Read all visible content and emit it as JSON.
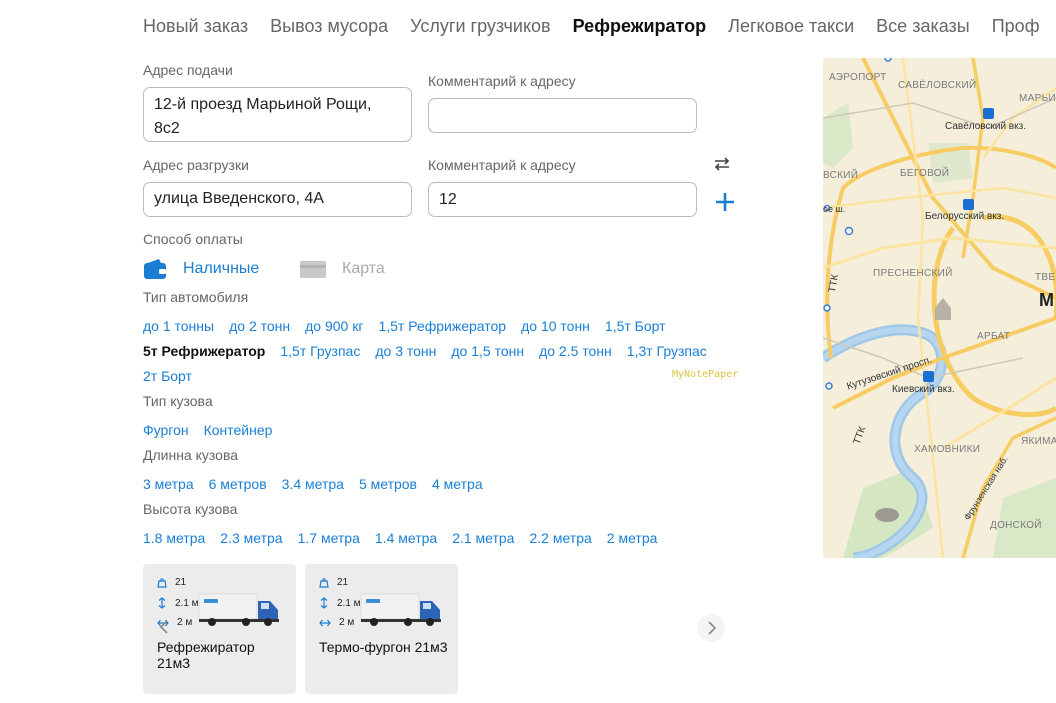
{
  "nav": {
    "items": [
      {
        "label": "Новый заказ",
        "active": false
      },
      {
        "label": "Вывоз мусора",
        "active": false
      },
      {
        "label": "Услуги грузчиков",
        "active": false
      },
      {
        "label": "Рефрежиратор",
        "active": true
      },
      {
        "label": "Легковое такси",
        "active": false
      },
      {
        "label": "Все заказы",
        "active": false
      },
      {
        "label": "Проф",
        "active": false
      }
    ]
  },
  "pickup": {
    "label": "Адрес подачи",
    "value": "12-й проезд Марьиной Рощи, 8с2",
    "comment_label": "Комментарий к адресу",
    "comment_value": ""
  },
  "unload": {
    "label": "Адрес разгрузки",
    "value": "улица Введенского, 4А",
    "comment_label": "Комментарий к адресу",
    "comment_value": "12"
  },
  "payment": {
    "label": "Способ оплаты",
    "cash": "Наличные",
    "card": "Карта",
    "cash_color": "#1a7fd4"
  },
  "vehicle_type": {
    "label": "Тип автомобиля",
    "rows": [
      [
        "до 1 тонны",
        "до 2 тонн",
        "до 900 кг",
        "1,5т Рефрижератор",
        "до 10 тонн",
        "1,5т Борт"
      ],
      [
        "5т Рефрижератор",
        "1,5т Грузпас",
        "до 3 тонн",
        "до 1,5 тонн",
        "до 2.5 тонн",
        "1,3т Грузпас"
      ],
      [
        "2т Борт"
      ]
    ],
    "selected": "5т Рефрижератор"
  },
  "watermark": "MyNotePaper",
  "body_type": {
    "label": "Тип кузова",
    "options": [
      "Фургон",
      "Контейнер"
    ]
  },
  "body_length": {
    "label": "Длинна кузова",
    "options": [
      "3 метра",
      "6 метров",
      "3.4 метра",
      "5 метров",
      "4 метра"
    ]
  },
  "body_height": {
    "label": "Высота кузова",
    "options": [
      "1.8 метра",
      "2.3 метра",
      "1.7 метра",
      "1.4 метра",
      "2.1 метра",
      "2.2 метра",
      "2 метра"
    ]
  },
  "cards": [
    {
      "volume": "21",
      "height": "2.1 м",
      "width": "2 м",
      "title": "Рефрежиратор 21м3"
    },
    {
      "volume": "21",
      "height": "2.1 м",
      "width": "2 м",
      "title": "Термо-фургон 21м3"
    }
  ],
  "map": {
    "labels": [
      "АЭРОПОРТ",
      "САВЁЛОВСКИЙ",
      "МАРЬИ",
      "Савёловский вкз.",
      "ВСКИЙ",
      "БЕГОВОЙ",
      "Белорусский вкз.",
      "ПРЕСНЕНСКИЙ",
      "ТВЕ",
      "М",
      "АРБАТ",
      "Кутузовский просп.",
      "Киевский вкз.",
      "ХАМОВНИКИ",
      "ЯКИМА",
      "ДОНСКОЙ",
      "ТТК",
      "ТТК",
      "Фрунзенская наб.",
      "ое ш."
    ]
  }
}
